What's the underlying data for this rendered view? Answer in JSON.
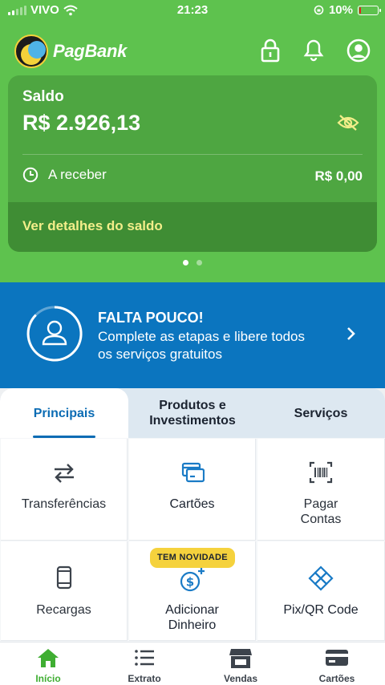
{
  "status_bar": {
    "carrier": "VIVO",
    "time": "21:23",
    "battery": "10%",
    "battery_level": 0.1
  },
  "header": {
    "brand": "PagBank",
    "icons": [
      "lock-icon",
      "bell-icon",
      "profile-icon"
    ]
  },
  "balance": {
    "label": "Saldo",
    "amount": "R$ 2.926,13",
    "receivable_label": "A receber",
    "receivable_value": "R$ 0,00",
    "details_link": "Ver detalhes do saldo"
  },
  "carousel": {
    "pages": 2,
    "active": 0
  },
  "promo": {
    "title": "FALTA POUCO!",
    "description": "Complete as etapas e libere todos os serviços gratuitos"
  },
  "tabs": [
    {
      "label": "Principais",
      "active": true
    },
    {
      "label": "Produtos e Investimentos",
      "active": false
    },
    {
      "label": "Serviços",
      "active": false
    }
  ],
  "services": [
    {
      "label": "Transferências",
      "icon": "transfer-arrows-icon"
    },
    {
      "label": "Cartões",
      "icon": "cards-icon"
    },
    {
      "label": "Pagar Contas",
      "icon": "barcode-icon"
    },
    {
      "label": "Recargas",
      "icon": "phone-icon"
    },
    {
      "label": "Adicionar Dinheiro",
      "icon": "add-money-icon",
      "badge": "TEM NOVIDADE"
    },
    {
      "label": "Pix/QR Code",
      "icon": "pix-icon"
    }
  ],
  "bottom_nav": [
    {
      "label": "Início",
      "icon": "home-icon",
      "active": true
    },
    {
      "label": "Extrato",
      "icon": "list-icon",
      "active": false
    },
    {
      "label": "Vendas",
      "icon": "store-icon",
      "active": false
    },
    {
      "label": "Cartões",
      "icon": "card-icon",
      "active": false
    }
  ],
  "colors": {
    "green": "#5ec24e",
    "card_green": "#4ea641",
    "blue": "#0b75bf",
    "accent_blue": "#0b6cb4",
    "highlight_yellow": "#f3ee8a",
    "badge_yellow": "#f5d23d"
  }
}
